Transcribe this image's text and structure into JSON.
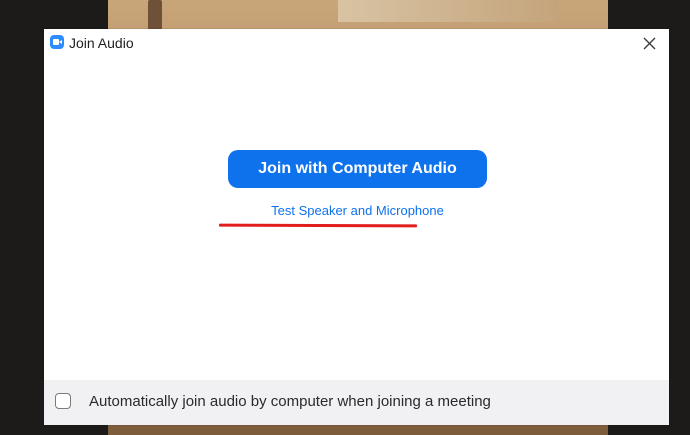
{
  "window": {
    "title": "Join Audio",
    "app_icon": "zoom-camera-icon",
    "close_icon": "close-icon"
  },
  "main": {
    "join_button_label": "Join with Computer Audio",
    "test_link_label": "Test Speaker and Microphone"
  },
  "footer": {
    "auto_join_label": "Automatically join audio by computer when joining a meeting",
    "auto_join_checked": false
  },
  "colors": {
    "accent": "#0e72ed",
    "annotation_red": "#e21d1d",
    "footer_bg": "#f1f1f3"
  }
}
